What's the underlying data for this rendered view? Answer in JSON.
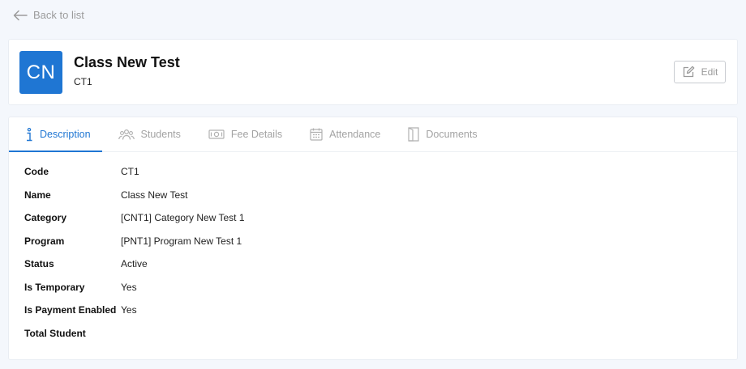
{
  "nav": {
    "back_label": "Back to list"
  },
  "header": {
    "avatar_initials": "CN",
    "title": "Class New Test",
    "subtitle": "CT1",
    "edit_label": "Edit"
  },
  "tabs": [
    {
      "label": "Description",
      "icon": "info-icon",
      "active": true
    },
    {
      "label": "Students",
      "icon": "people-icon",
      "active": false
    },
    {
      "label": "Fee Details",
      "icon": "money-icon",
      "active": false
    },
    {
      "label": "Attendance",
      "icon": "calendar-icon",
      "active": false
    },
    {
      "label": "Documents",
      "icon": "document-icon",
      "active": false
    }
  ],
  "fields": [
    {
      "label": "Code",
      "value": "CT1"
    },
    {
      "label": "Name",
      "value": "Class New Test"
    },
    {
      "label": "Category",
      "value": "[CNT1] Category New Test 1"
    },
    {
      "label": "Program",
      "value": "[PNT1] Program New Test 1"
    },
    {
      "label": "Status",
      "value": "Active"
    },
    {
      "label": "Is Temporary",
      "value": "Yes"
    },
    {
      "label": "Is Payment Enabled",
      "value": "Yes"
    },
    {
      "label": "Total Student",
      "value": ""
    }
  ],
  "colors": {
    "accent": "#1f76d3",
    "background": "#f4f7fc",
    "muted_text": "#a3a3a3"
  }
}
